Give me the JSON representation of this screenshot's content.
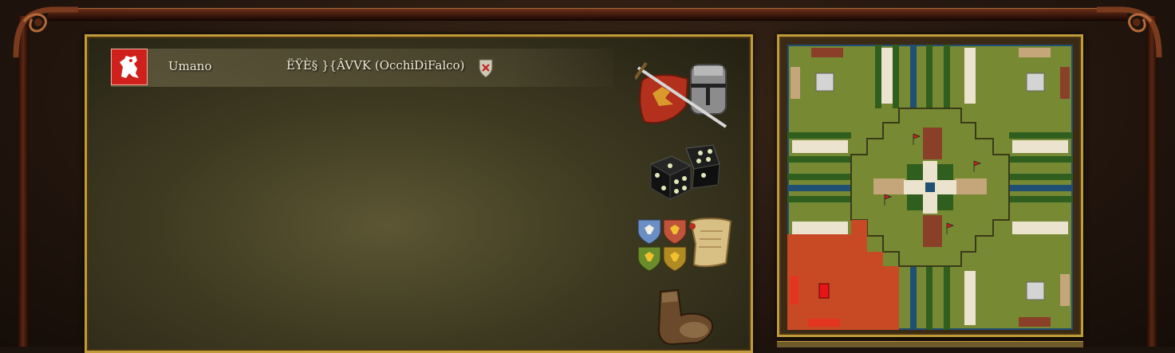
{
  "player_panel": {
    "players": [
      {
        "type": "Umano",
        "name": "ËŸÈ§ }{ÂVVK (OcchiDiFalco)",
        "color": "#d0201b"
      }
    ]
  },
  "actions": [
    {
      "icon": "sword-helmet-shield-icon"
    },
    {
      "icon": "dice-icon"
    },
    {
      "icon": "heraldic-shields-scroll-icon"
    },
    {
      "icon": "boot-icon"
    }
  ],
  "map": {
    "grass_color": "#778a33",
    "player_zone_color": "#c84a25"
  }
}
